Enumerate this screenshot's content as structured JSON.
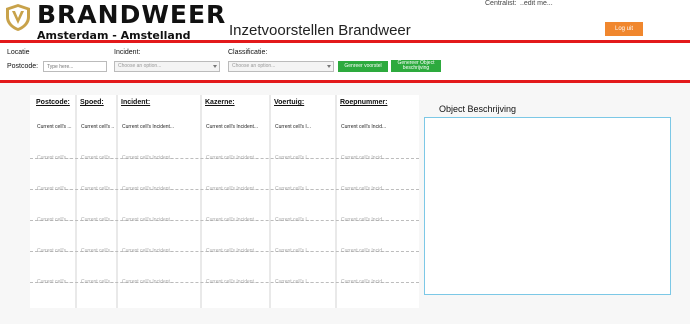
{
  "header": {
    "brand": "BRANDWEER",
    "region": "Amsterdam - Amstelland",
    "app_title": "Inzetvoorstellen Brandweer",
    "user_label": "Centralist:",
    "user_value": "..edit me...",
    "logout_label": "Log uit"
  },
  "filters": {
    "locatie_label": "Locatie",
    "postcode_label": "Postcode:",
    "postcode_placeholder": "Type here...",
    "incident_label": "Incident:",
    "incident_placeholder": "Choose an option...",
    "classificatie_label": "Classificatie:",
    "classificatie_placeholder": "Choose an option...",
    "generate_button": "Genreer voorstel",
    "generate_object_button": "Genereer Object beschrijving"
  },
  "table": {
    "columns": [
      "Postcode:",
      "Spoed:",
      "Incident:",
      "Kazerne:",
      "Voertuig:",
      "Roepnummer:"
    ],
    "rows": [
      [
        "Current cell's ...",
        "Current cell's ...",
        "Current cell's Incident...",
        "Current cell's Incident...",
        "Current cell's I...",
        "Current cell's Incid..."
      ],
      [
        "Current cell's ...",
        "Current cell's ...",
        "Current cell's Incident...",
        "Current cell's Incident...",
        "Current cell's I...",
        "Current cell's Incid..."
      ],
      [
        "Current cell's ...",
        "Current cell's ...",
        "Current cell's Incident...",
        "Current cell's Incident...",
        "Current cell's I...",
        "Current cell's Incid..."
      ],
      [
        "Current cell's ...",
        "Current cell's ...",
        "Current cell's Incident...",
        "Current cell's Incident...",
        "Current cell's I...",
        "Current cell's Incid..."
      ],
      [
        "Current cell's ...",
        "Current cell's ...",
        "Current cell's Incident...",
        "Current cell's Incident...",
        "Current cell's I...",
        "Current cell's Incid..."
      ],
      [
        "Current cell's ...",
        "Current cell's ...",
        "Current cell's Incident...",
        "Current cell's Incident...",
        "Current cell's I...",
        "Current cell's Incid..."
      ]
    ]
  },
  "object_panel": {
    "title": "Object Beschrijving"
  },
  "colors": {
    "accent_red": "#e3191b",
    "logout_orange": "#f0872e",
    "button_green": "#2daa3e",
    "panel_border": "#7cc8e6",
    "logo_gold": "#c8a24a"
  },
  "icons": {
    "logo": "shield-crest-icon",
    "select_caret": "chevron-down-icon"
  }
}
